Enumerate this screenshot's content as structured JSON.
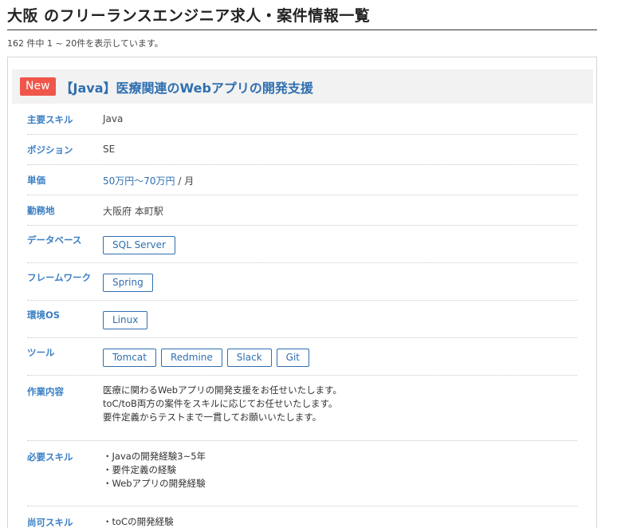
{
  "page": {
    "title": "大阪 のフリーランスエンジニア求人・案件情報一覧",
    "result_count": "162 件中 1 ~ 20件を表示しています。"
  },
  "job": {
    "badge": "New",
    "title": "【Java】医療関連のWebアプリの開発支援",
    "fields": {
      "skill": {
        "label": "主要スキル",
        "value": "Java"
      },
      "position": {
        "label": "ポジション",
        "value": "SE"
      },
      "price": {
        "label": "単価",
        "value": "50万円〜70万円",
        "unit": " / 月"
      },
      "location": {
        "label": "勤務地",
        "value": "大阪府 本町駅"
      },
      "database": {
        "label": "データベース",
        "tags": [
          "SQL Server"
        ]
      },
      "framework": {
        "label": "フレームワーク",
        "tags": [
          "Spring"
        ]
      },
      "os": {
        "label": "環境OS",
        "tags": [
          "Linux"
        ]
      },
      "tools": {
        "label": "ツール",
        "tags": [
          "Tomcat",
          "Redmine",
          "Slack",
          "Git"
        ]
      },
      "work": {
        "label": "作業内容",
        "lines": [
          "医療に関わるWebアプリの開発支援をお任せいたします。",
          "toC/toB両方の案件をスキルに応じてお任せいたします。",
          "要件定義からテストまで一貫してお願いいたします。"
        ]
      },
      "required": {
        "label": "必要スキル",
        "lines": [
          "・Javaの開発経験3~5年",
          "・要件定義の経験",
          "・Webアプリの開発経験"
        ]
      },
      "preferred": {
        "label": "尚可スキル",
        "lines": [
          "・toCの開発経験"
        ]
      }
    }
  },
  "colors": {
    "accent_blue": "#2f6fb0",
    "label_blue": "#3a7fc4",
    "badge_red": "#f0554a",
    "header_bg": "#f2f2f2"
  }
}
